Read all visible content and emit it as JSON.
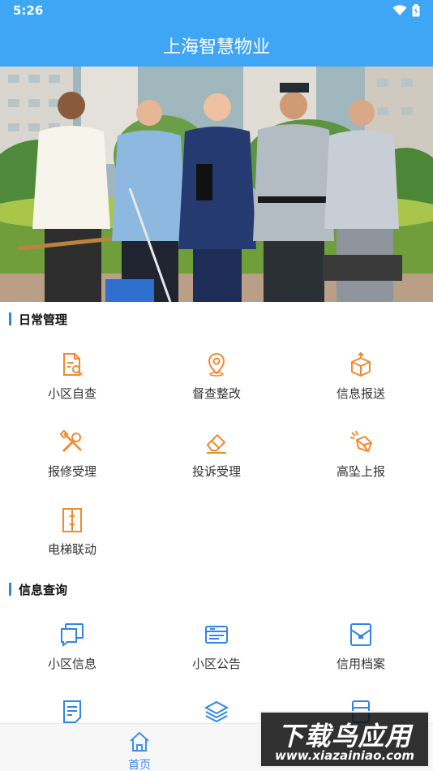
{
  "status_bar": {
    "time": "5:26",
    "wifi_icon": "wifi-icon",
    "battery_icon": "battery-icon"
  },
  "header": {
    "title": "上海智慧物业",
    "background": "#3fa5f5"
  },
  "banner": {
    "description_icon": "staff-photo-banner"
  },
  "sections": {
    "daily": {
      "title": "日常管理",
      "items": [
        {
          "label": "小区自查",
          "icon": "document-search-icon",
          "color": "#f28a2e"
        },
        {
          "label": "督查整改",
          "icon": "location-pin-icon",
          "color": "#f28a2e"
        },
        {
          "label": "信息报送",
          "icon": "box-upload-icon",
          "color": "#f28a2e"
        },
        {
          "label": "报修受理",
          "icon": "wrench-tools-icon",
          "color": "#f28a2e"
        },
        {
          "label": "投诉受理",
          "icon": "eraser-icon",
          "color": "#f28a2e"
        },
        {
          "label": "高坠上报",
          "icon": "falling-box-icon",
          "color": "#f28a2e"
        },
        {
          "label": "电梯联动",
          "icon": "elevator-icon",
          "color": "#f28a2e"
        }
      ]
    },
    "query": {
      "title": "信息查询",
      "items": [
        {
          "label": "小区信息",
          "icon": "chat-windows-icon",
          "color": "#2f86e8"
        },
        {
          "label": "小区公告",
          "icon": "notice-card-icon",
          "color": "#2f86e8"
        },
        {
          "label": "信用档案",
          "icon": "archive-envelope-icon",
          "color": "#2f86e8"
        },
        {
          "label": "",
          "icon": "document-lines-icon",
          "color": "#2f86e8"
        },
        {
          "label": "",
          "icon": "layers-icon",
          "color": "#2f86e8"
        },
        {
          "label": "",
          "icon": "cabinet-icon",
          "color": "#2f86e8"
        }
      ]
    }
  },
  "tab_bar": {
    "home_label": "首页",
    "home_icon": "home-icon",
    "active_color": "#3f8ff0"
  },
  "watermark": {
    "title": "下载鸟应用",
    "url": "www.xiazainiao.com"
  }
}
